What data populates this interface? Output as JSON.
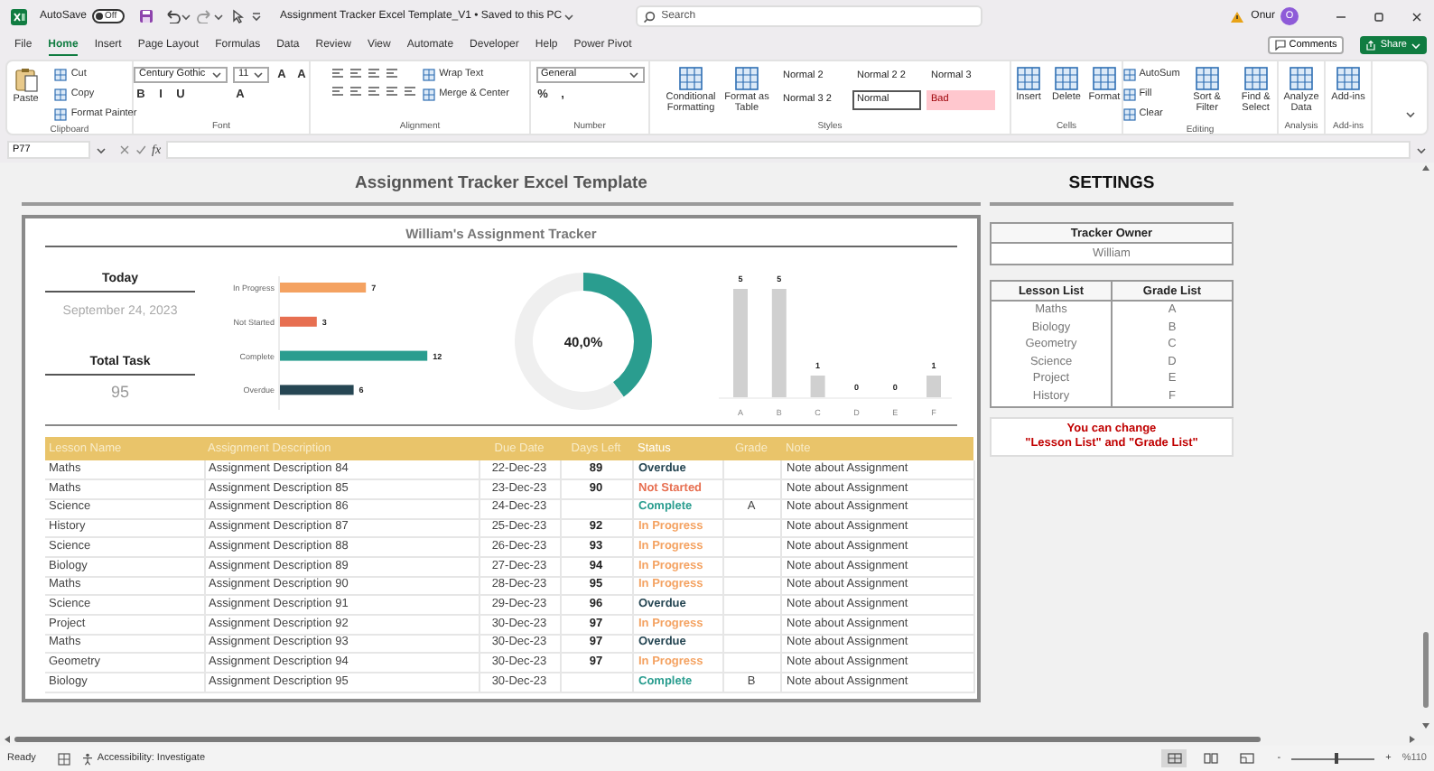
{
  "title_bar": {
    "autosave_label": "AutoSave",
    "autosave_on": false,
    "autosave_state": "Off",
    "title": "Assignment Tracker Excel Template_V1 • Saved to this PC",
    "search_placeholder": "Search",
    "user": "Onur",
    "avatar": "O"
  },
  "menu_tabs": [
    {
      "label": "File",
      "selected": false
    },
    {
      "label": "Home",
      "selected": true
    },
    {
      "label": "Insert",
      "selected": false
    },
    {
      "label": "Page Layout",
      "selected": false
    },
    {
      "label": "Formulas",
      "selected": false
    },
    {
      "label": "Data",
      "selected": false
    },
    {
      "label": "Review",
      "selected": false
    },
    {
      "label": "View",
      "selected": false
    },
    {
      "label": "Automate",
      "selected": false
    },
    {
      "label": "Developer",
      "selected": false
    },
    {
      "label": "Help",
      "selected": false
    },
    {
      "label": "Power Pivot",
      "selected": false
    }
  ],
  "comments": "Comments",
  "share": "Share",
  "ribbon": [
    {
      "label": "Clipboard",
      "columns": [
        [
          {
            "kind": "large",
            "label": "Paste"
          }
        ],
        [
          {
            "kind": "small",
            "label": "Cut"
          },
          {
            "kind": "small",
            "label": "Copy"
          },
          {
            "kind": "small",
            "label": "Format Painter"
          }
        ]
      ]
    },
    {
      "label": "Font",
      "columns": [
        [
          {
            "kind": "select",
            "label": "Century Gothic"
          },
          {
            "kind": "glyphs",
            "labels": [
              "B",
              "I",
              "U"
            ]
          }
        ],
        [
          {
            "kind": "select",
            "label": "11"
          },
          {
            "kind": "glyphs",
            "labels": [
              "A"
            ]
          }
        ],
        [
          {
            "kind": "glyphs",
            "labels": [
              "A",
              "A"
            ]
          }
        ]
      ]
    },
    {
      "label": "Alignment",
      "columns": [
        [
          {
            "kind": "small",
            "label": "Wrap Text"
          },
          {
            "kind": "small",
            "label": "Merge & Center"
          }
        ]
      ]
    },
    {
      "label": "Number",
      "columns": [
        [
          {
            "kind": "select",
            "label": "General"
          },
          {
            "kind": "glyphs",
            "labels": [
              "%",
              ","
            ]
          }
        ]
      ]
    },
    {
      "label": "Styles",
      "columns": [
        [
          {
            "kind": "large",
            "label": "Conditional Formatting"
          }
        ],
        [
          {
            "kind": "large",
            "label": "Format as Table"
          }
        ],
        [
          {
            "kind": "style",
            "label": "Normal 2",
            "selected": false
          },
          {
            "kind": "style",
            "label": "Normal 3 2",
            "selected": false
          }
        ],
        [
          {
            "kind": "style",
            "label": "Normal 2 2",
            "selected": false
          },
          {
            "kind": "style",
            "label": "Normal",
            "selected": true
          }
        ],
        [
          {
            "kind": "style",
            "label": "Normal 3",
            "selected": false
          },
          {
            "kind": "bad_style",
            "label": "Bad",
            "selected": false
          }
        ]
      ]
    },
    {
      "label": "Cells",
      "columns": [
        [
          {
            "kind": "large",
            "label": "Insert"
          }
        ],
        [
          {
            "kind": "large",
            "label": "Delete"
          }
        ],
        [
          {
            "kind": "large",
            "label": "Format"
          }
        ]
      ]
    },
    {
      "label": "Editing",
      "columns": [
        [
          {
            "kind": "small",
            "label": "AutoSum"
          },
          {
            "kind": "small",
            "label": "Fill"
          },
          {
            "kind": "small",
            "label": "Clear"
          }
        ],
        [
          {
            "kind": "large",
            "label": "Sort & Filter"
          }
        ],
        [
          {
            "kind": "large",
            "label": "Find & Select"
          }
        ]
      ]
    },
    {
      "label": "Analysis",
      "columns": [
        [
          {
            "kind": "large",
            "label": "Analyze Data"
          }
        ]
      ]
    },
    {
      "label": "Add-ins",
      "columns": [
        [
          {
            "kind": "large",
            "label": "Add-ins"
          }
        ]
      ]
    }
  ],
  "formula_bar": {
    "name_box": "P77",
    "function_label": "fx"
  },
  "sheet": {
    "title": "Assignment Tracker Excel Template",
    "tracker_title": "William's Assignment Tracker",
    "today_label": "Today",
    "today": "September 24, 2023",
    "total_label": "Total Task",
    "total": "95",
    "status_chart": {
      "chart_data": {
        "type": "bar",
        "orientation": "horizontal",
        "stacked": true,
        "categories": [
          "In Progress",
          "Not Started",
          "Complete",
          "Overdue"
        ],
        "data_labels": true,
        "series": [
          {
            "color": "#f4a261",
            "values": [
              7,
              null,
              null,
              null
            ]
          },
          {
            "color": "#e76f51",
            "values": [
              null,
              3,
              null,
              null
            ]
          },
          {
            "color": "#2a9d8f",
            "values": [
              null,
              null,
              12,
              null
            ]
          },
          {
            "color": "#264653",
            "values": [
              null,
              null,
              null,
              6
            ]
          }
        ]
      }
    },
    "completion": {
      "center_label": "40,0%",
      "chart_data": {
        "type": "donut",
        "values": [
          40,
          60
        ]
      }
    },
    "grade_chart": {
      "chart_data": {
        "type": "bar",
        "categories": [
          "A",
          "B",
          "C",
          "D",
          "E",
          "F"
        ],
        "data_labels": true,
        "series": [
          {
            "color": "#d0d0d0",
            "values": [
              5,
              5,
              1,
              0,
              0,
              1
            ]
          }
        ]
      }
    },
    "table": {
      "columns": [
        {
          "label": "Lesson Name",
          "highlighted": false
        },
        {
          "label": "Assignment Description",
          "highlighted": false
        },
        {
          "label": "Due Date",
          "highlighted": false
        },
        {
          "label": "Days Left",
          "highlighted": false
        },
        {
          "label": "Status",
          "highlighted": true
        },
        {
          "label": "Grade",
          "highlighted": false
        },
        {
          "label": "Note",
          "highlighted": false
        }
      ],
      "rows": [
        {
          "lesson": "Maths",
          "description": "Assignment Description 84",
          "due": "22-Dec-23",
          "days_left": "89",
          "status": "Overdue",
          "color": "#264653",
          "note": "Note about Assignment"
        },
        {
          "lesson": "Maths",
          "description": "Assignment Description 85",
          "due": "23-Dec-23",
          "days_left": "90",
          "status": "Not Started",
          "color": "#e76f51",
          "note": "Note about Assignment"
        },
        {
          "lesson": "Science",
          "description": "Assignment Description 86",
          "due": "24-Dec-23",
          "status": "Complete",
          "color": "#2a9d8f",
          "grade": "A",
          "note": "Note about Assignment"
        },
        {
          "lesson": "History",
          "description": "Assignment Description 87",
          "due": "25-Dec-23",
          "days_left": "92",
          "status": "In Progress",
          "color": "#f4a261",
          "note": "Note about Assignment"
        },
        {
          "lesson": "Science",
          "description": "Assignment Description 88",
          "due": "26-Dec-23",
          "days_left": "93",
          "status": "In Progress",
          "color": "#f4a261",
          "note": "Note about Assignment"
        },
        {
          "lesson": "Biology",
          "description": "Assignment Description 89",
          "due": "27-Dec-23",
          "days_left": "94",
          "status": "In Progress",
          "color": "#f4a261",
          "note": "Note about Assignment"
        },
        {
          "lesson": "Maths",
          "description": "Assignment Description 90",
          "due": "28-Dec-23",
          "days_left": "95",
          "status": "In Progress",
          "color": "#f4a261",
          "note": "Note about Assignment"
        },
        {
          "lesson": "Science",
          "description": "Assignment Description 91",
          "due": "29-Dec-23",
          "days_left": "96",
          "status": "Overdue",
          "color": "#264653",
          "note": "Note about Assignment"
        },
        {
          "lesson": "Project",
          "description": "Assignment Description 92",
          "due": "30-Dec-23",
          "days_left": "97",
          "status": "In Progress",
          "color": "#f4a261",
          "note": "Note about Assignment"
        },
        {
          "lesson": "Maths",
          "description": "Assignment Description 93",
          "due": "30-Dec-23",
          "days_left": "97",
          "status": "Overdue",
          "color": "#264653",
          "note": "Note about Assignment"
        },
        {
          "lesson": "Geometry",
          "description": "Assignment Description 94",
          "due": "30-Dec-23",
          "days_left": "97",
          "status": "In Progress",
          "color": "#f4a261",
          "note": "Note about Assignment"
        },
        {
          "lesson": "Biology",
          "description": "Assignment Description 95",
          "due": "30-Dec-23",
          "status": "Complete",
          "color": "#2a9d8f",
          "grade": "B",
          "note": "Note about Assignment"
        }
      ]
    }
  },
  "settings": {
    "title": "SETTINGS",
    "owner_label": "Tracker Owner",
    "owner": "William",
    "list_columns": [
      "Lesson List",
      "Grade List"
    ],
    "lessons": [
      "Maths",
      "Biology",
      "Geometry",
      "Science",
      "Project",
      "History"
    ],
    "grades": [
      "A",
      "B",
      "C",
      "D",
      "E",
      "F"
    ],
    "note_lines": [
      "You can change",
      "\"Lesson List\" and \"Grade List\""
    ]
  },
  "status_bar": {
    "status": "Ready",
    "accessibility": "Accessibility: Investigate",
    "views": [
      {
        "selected": true
      },
      {
        "selected": false
      },
      {
        "selected": false
      }
    ],
    "zoom_out": "-",
    "zoom_in": "+",
    "zoom": {
      "level": 0.55,
      "reading": "%110"
    }
  }
}
